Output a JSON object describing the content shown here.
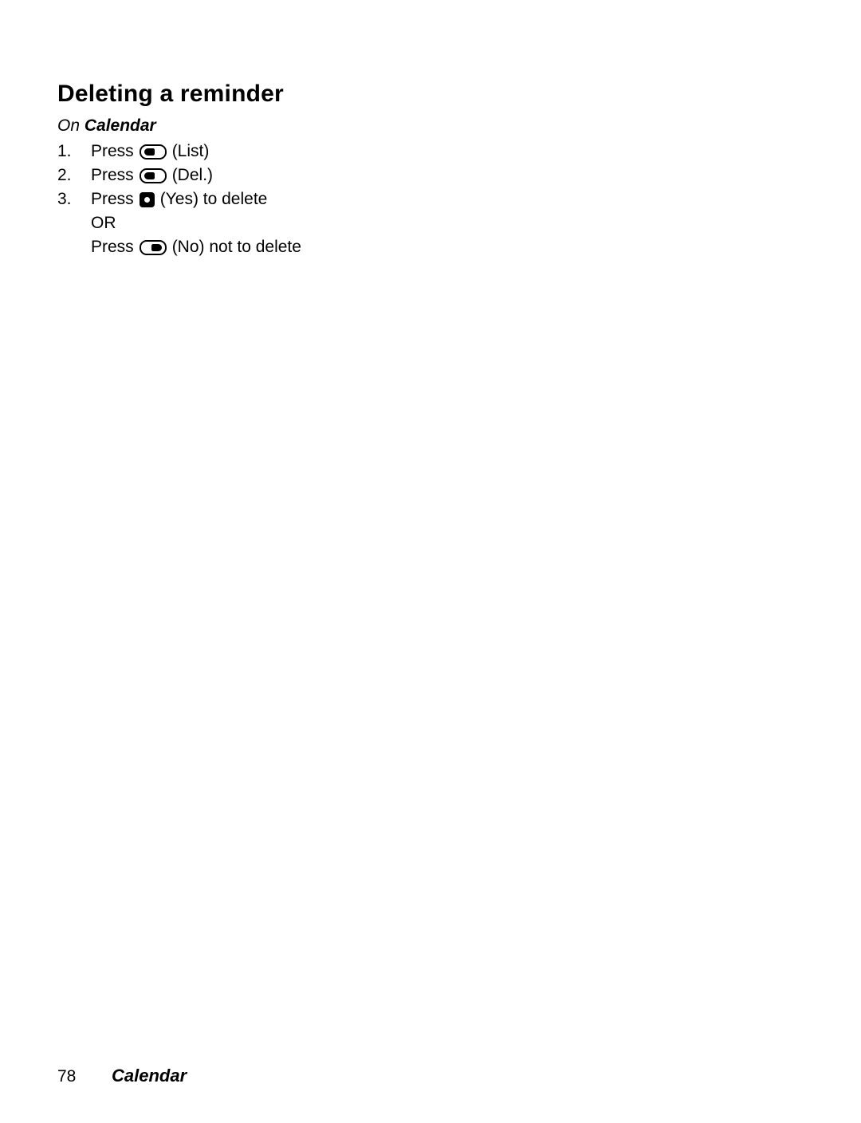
{
  "document": {
    "heading": "Deleting a reminder",
    "subheading_lead": "On ",
    "subheading_emphasis": "Calendar",
    "steps": [
      {
        "number": "1.",
        "prefix": "Press",
        "key": "left-softkey-icon",
        "suffix": "(List)"
      },
      {
        "number": "2.",
        "prefix": "Press",
        "key": "left-softkey-icon",
        "suffix": "(Del.)"
      },
      {
        "number": "3.",
        "prefix": "Press",
        "key": "center-select-key-icon",
        "suffix": "(Yes) to delete"
      }
    ],
    "or_label": "OR",
    "alternate": {
      "prefix": "Press",
      "key": "right-softkey-icon",
      "suffix": "(No) not to delete"
    }
  },
  "footer": {
    "page_number": "78",
    "section_title": "Calendar"
  }
}
